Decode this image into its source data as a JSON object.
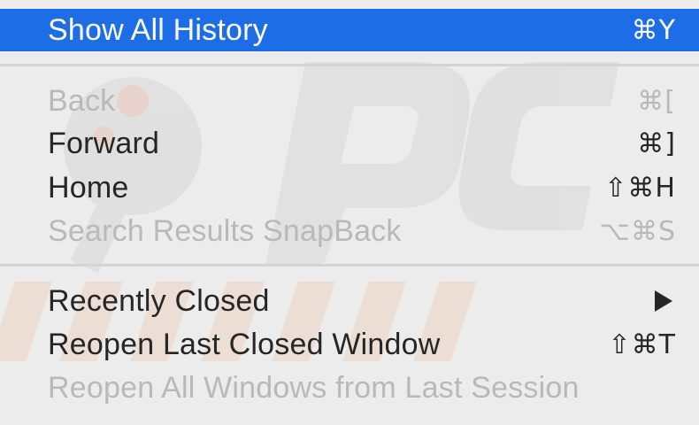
{
  "menu": {
    "items": [
      {
        "label": "Show All History",
        "shortcut": "⌘Y",
        "state": "selected"
      },
      {
        "label": "Back",
        "shortcut": "⌘[",
        "state": "disabled"
      },
      {
        "label": "Forward",
        "shortcut": "⌘]",
        "state": "enabled"
      },
      {
        "label": "Home",
        "shortcut": "⇧⌘H",
        "state": "enabled"
      },
      {
        "label": "Search Results SnapBack",
        "shortcut": "⌥⌘S",
        "state": "disabled"
      },
      {
        "label": "Recently Closed",
        "shortcut": "",
        "state": "enabled",
        "submenu_icon": "triangle-right-icon"
      },
      {
        "label": "Reopen Last Closed Window",
        "shortcut": "⇧⌘T",
        "state": "enabled"
      },
      {
        "label": "Reopen All Windows from Last Session",
        "shortcut": "",
        "state": "disabled"
      }
    ]
  },
  "colors": {
    "menu_background": "#ececec",
    "selection": "#1d6ee6",
    "text": "#262626",
    "disabled_text": "#b9b9b9"
  }
}
